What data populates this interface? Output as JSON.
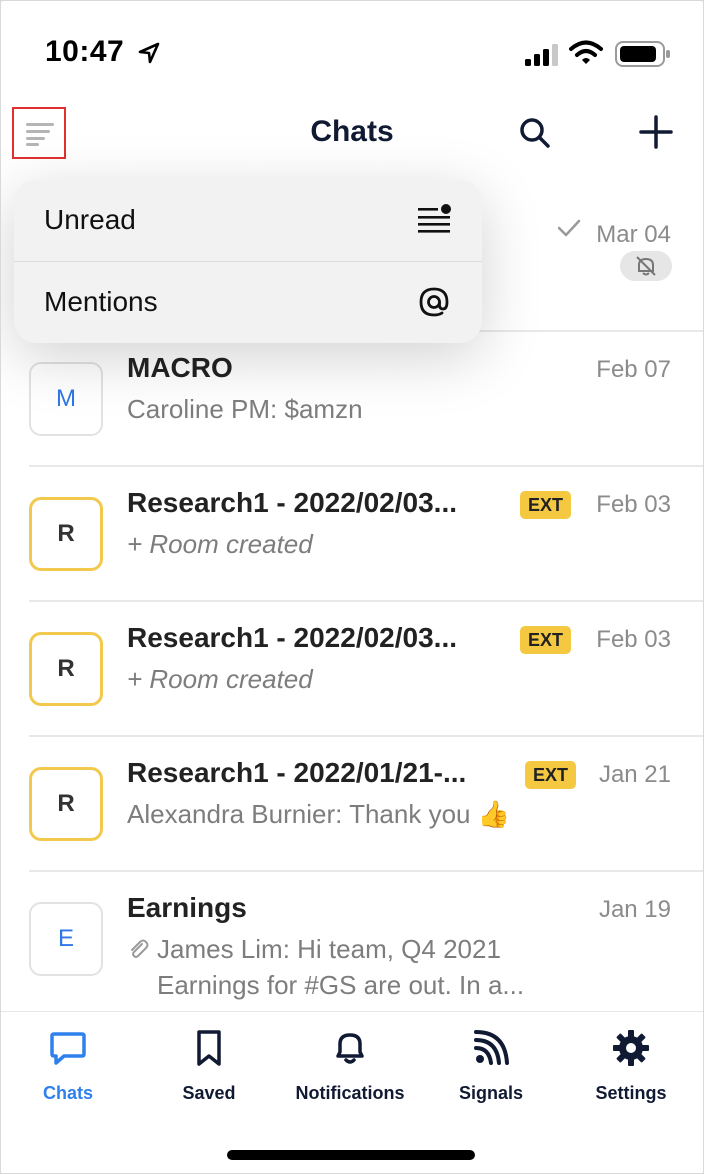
{
  "status_bar": {
    "time": "10:47"
  },
  "header": {
    "title": "Chats"
  },
  "dropdown": {
    "items": [
      {
        "label": "Unread",
        "icon": "unread-list-icon"
      },
      {
        "label": "Mentions",
        "icon": "at-icon"
      }
    ]
  },
  "hidden_row": {
    "date": "Mar 04",
    "sub_tail": "."
  },
  "chats": [
    {
      "avatar_letter": "M",
      "title": "MACRO",
      "date": "Feb 07",
      "subtitle": "Caroline PM: $amzn",
      "ext": ""
    },
    {
      "avatar_letter": "R",
      "title": "Research1 - 2022/02/03...",
      "date": "Feb 03",
      "subtitle": "+ Room created",
      "ext": "EXT"
    },
    {
      "avatar_letter": "R",
      "title": "Research1 - 2022/02/03...",
      "date": "Feb 03",
      "subtitle": "+ Room created",
      "ext": "EXT"
    },
    {
      "avatar_letter": "R",
      "title": "Research1 - 2022/01/21-...",
      "date": "Jan 21",
      "subtitle": "Alexandra Burnier: Thank you 👍",
      "ext": "EXT"
    },
    {
      "avatar_letter": "E",
      "title": "Earnings",
      "date": "Jan 19",
      "subtitle": "James Lim: Hi team, Q4 2021",
      "subtitle2": "Earnings for #GS are out. In a...",
      "ext": ""
    }
  ],
  "tabs": [
    {
      "label": "Chats",
      "icon": "chat-bubble-icon",
      "active": true
    },
    {
      "label": "Saved",
      "icon": "bookmark-icon"
    },
    {
      "label": "Notifications",
      "icon": "bell-icon"
    },
    {
      "label": "Signals",
      "icon": "signal-rss-icon"
    },
    {
      "label": "Settings",
      "icon": "gear-icon"
    }
  ],
  "colors": {
    "accent": "#2f80ed",
    "ext_badge": "#f5c842",
    "highlight_border": "#e0312f"
  }
}
